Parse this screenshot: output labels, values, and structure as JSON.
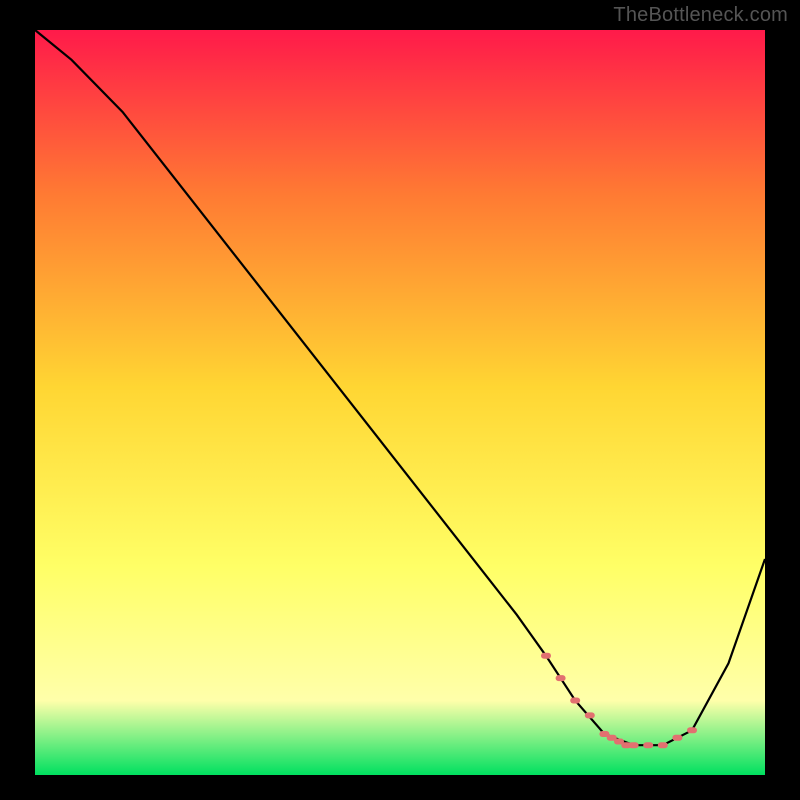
{
  "watermark": "TheBottleneck.com",
  "colors": {
    "gradient_top": "#ff1a4a",
    "gradient_mid1": "#ff7a33",
    "gradient_mid2": "#ffd633",
    "gradient_mid3": "#ffff66",
    "gradient_mid4": "#ffffaa",
    "gradient_bottom": "#00e060",
    "curve": "#000000",
    "marker": "#e27070",
    "frame": "#000000"
  },
  "chart_data": {
    "type": "line",
    "title": "",
    "xlabel": "",
    "ylabel": "",
    "xlim": [
      0,
      100
    ],
    "ylim": [
      0,
      100
    ],
    "series": [
      {
        "name": "bottleneck-curve",
        "x": [
          0,
          5,
          12,
          20,
          30,
          40,
          50,
          58,
          62,
          66,
          70,
          74,
          78,
          82,
          86,
          90,
          95,
          100
        ],
        "values": [
          100,
          96,
          89,
          79,
          66.5,
          54,
          41.5,
          31.5,
          26.5,
          21.5,
          16,
          10,
          5.5,
          4,
          4,
          6,
          15,
          29
        ]
      }
    ],
    "markers": {
      "name": "highlight-band",
      "x": [
        70,
        72,
        74,
        76,
        78,
        79,
        80,
        81,
        82,
        84,
        86,
        88,
        90
      ],
      "values": [
        16,
        13,
        10,
        8,
        5.5,
        5,
        4.5,
        4,
        4,
        4,
        4,
        5,
        6
      ]
    }
  }
}
